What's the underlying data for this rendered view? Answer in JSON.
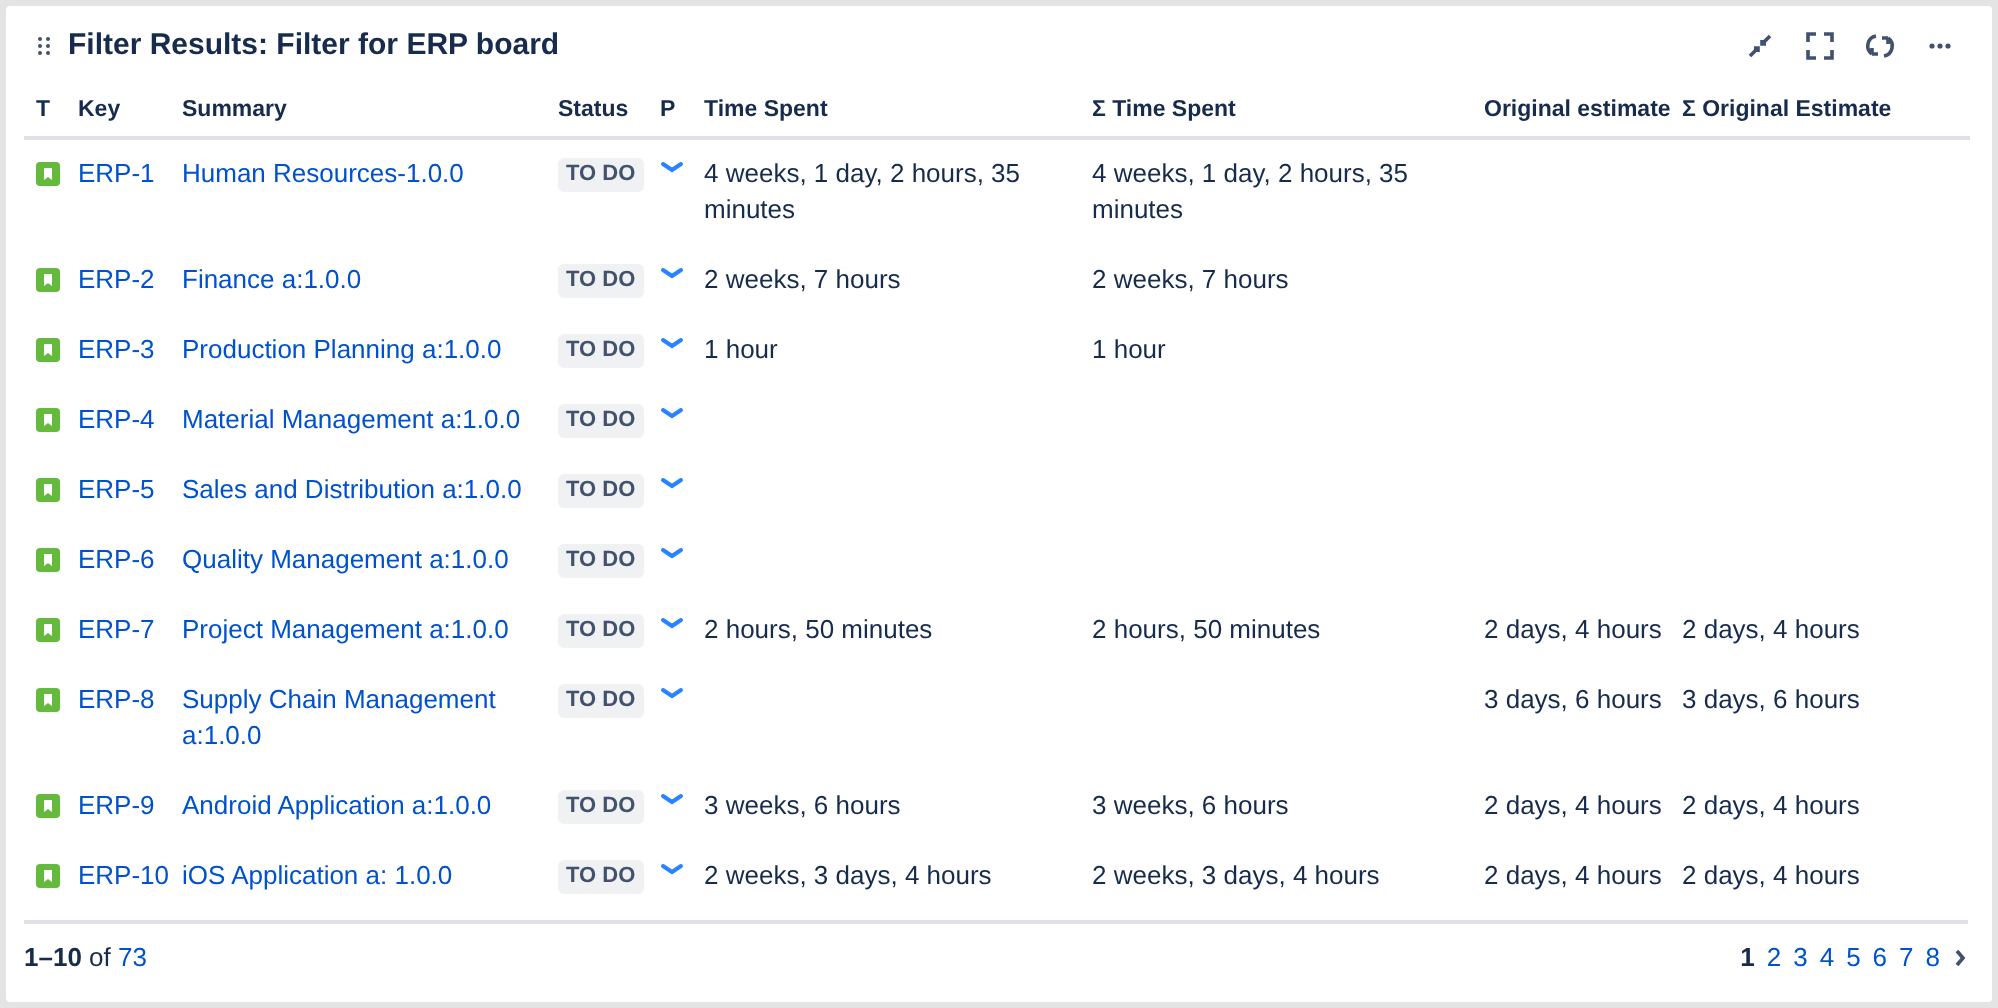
{
  "panel": {
    "title": "Filter Results: Filter for ERP board"
  },
  "table": {
    "columns": [
      "T",
      "Key",
      "Summary",
      "Status",
      "P",
      "Time Spent",
      "Σ Time Spent",
      "Original estimate",
      "Σ Original Estimate"
    ],
    "rows": [
      {
        "key": "ERP-1",
        "summary": "Human Resources-1.0.0",
        "status": "TO DO",
        "time_spent": "4 weeks, 1 day, 2 hours, 35 minutes",
        "sum_time_spent": "4 weeks, 1 day, 2 hours, 35 minutes"
      },
      {
        "key": "ERP-2",
        "summary": "Finance a:1.0.0",
        "status": "TO DO",
        "time_spent": "2 weeks, 7 hours",
        "sum_time_spent": "2 weeks, 7 hours"
      },
      {
        "key": "ERP-3",
        "summary": "Production Planning a:1.0.0",
        "status": "TO DO",
        "time_spent": "1 hour",
        "sum_time_spent": "1 hour"
      },
      {
        "key": "ERP-4",
        "summary": "Material Management a:1.0.0",
        "status": "TO DO"
      },
      {
        "key": "ERP-5",
        "summary": "Sales and Distribution a:1.0.0",
        "status": "TO DO"
      },
      {
        "key": "ERP-6",
        "summary": "Quality Management a:1.0.0",
        "status": "TO DO"
      },
      {
        "key": "ERP-7",
        "summary": "Project Management a:1.0.0",
        "status": "TO DO",
        "time_spent": "2 hours, 50 minutes",
        "sum_time_spent": "2 hours, 50 minutes",
        "original_estimate": "2 days, 4 hours",
        "sum_original_estimate": "2 days, 4 hours"
      },
      {
        "key": "ERP-8",
        "summary": "Supply Chain Management a:1.0.0",
        "status": "TO DO",
        "original_estimate": "3 days, 6 hours",
        "sum_original_estimate": "3 days, 6 hours"
      },
      {
        "key": "ERP-9",
        "summary": "Android Application a:1.0.0",
        "status": "TO DO",
        "time_spent": "3 weeks, 6 hours",
        "sum_time_spent": "3 weeks, 6 hours",
        "original_estimate": "2 days, 4 hours",
        "sum_original_estimate": "2 days, 4 hours"
      },
      {
        "key": "ERP-10",
        "summary": "iOS Application a: 1.0.0",
        "status": "TO DO",
        "time_spent": "2 weeks, 3 days, 4 hours",
        "sum_time_spent": "2 weeks, 3 days, 4 hours",
        "original_estimate": "2 days, 4 hours",
        "sum_original_estimate": "2 days, 4 hours"
      }
    ]
  },
  "footer": {
    "range": "1–10",
    "of": "of",
    "total": "73",
    "pages": [
      {
        "label": "1",
        "selected": true
      },
      {
        "label": "2",
        "selected": false
      },
      {
        "label": "3",
        "selected": false
      },
      {
        "label": "4",
        "selected": false
      },
      {
        "label": "5",
        "selected": false
      },
      {
        "label": "6",
        "selected": false
      },
      {
        "label": "7",
        "selected": false
      },
      {
        "label": "8",
        "selected": false
      }
    ]
  }
}
